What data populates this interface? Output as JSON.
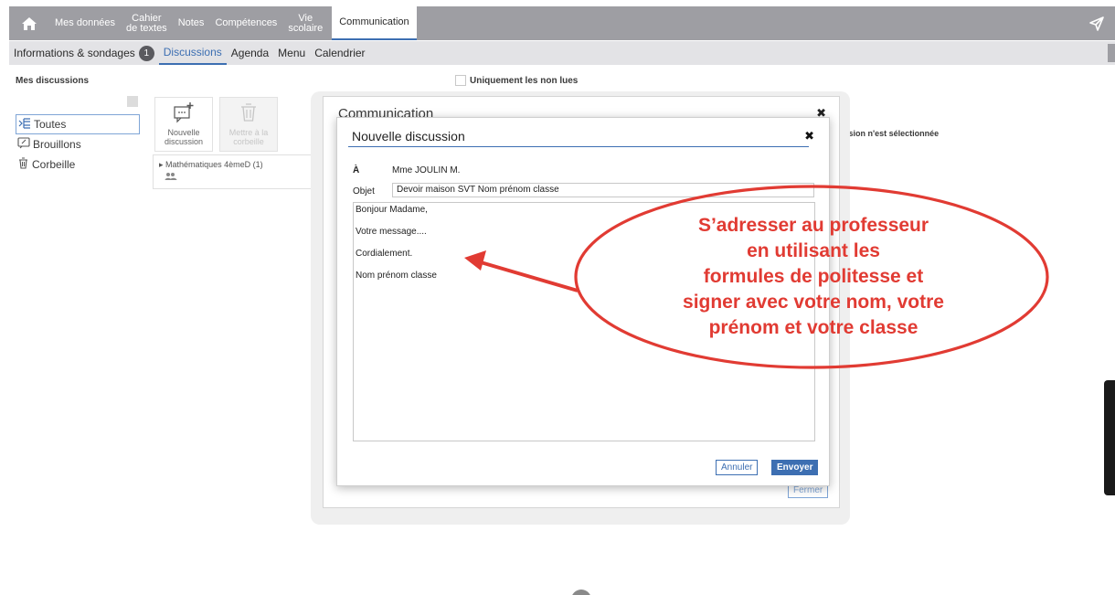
{
  "topnav": {
    "items": [
      {
        "label": "Mes données"
      },
      {
        "line1": "Cahier",
        "line2": "de textes"
      },
      {
        "label": "Notes"
      },
      {
        "label": "Compétences"
      },
      {
        "line1": "Vie",
        "line2": "scolaire"
      },
      {
        "label": "Communication",
        "active": true
      }
    ]
  },
  "subnav": {
    "items": [
      {
        "label": "Informations & sondages",
        "badge": "1"
      },
      {
        "label": "Discussions",
        "active": true
      },
      {
        "label": "Agenda"
      },
      {
        "label": "Menu"
      },
      {
        "label": "Calendrier"
      }
    ]
  },
  "sidebar": {
    "title": "Mes discussions",
    "items": [
      {
        "label": "Toutes",
        "active": true
      },
      {
        "label": "Brouillons"
      },
      {
        "label": "Corbeille"
      }
    ]
  },
  "filter": {
    "unread_label": "Uniquement les non lues"
  },
  "toolbar": {
    "new_line1": "Nouvelle",
    "new_line2": "discussion",
    "trash_line1": "Mettre à la",
    "trash_line2": "corbeille"
  },
  "discussion_list": [
    {
      "label": "Mathématiques 4èmeD (1)"
    }
  ],
  "detail": {
    "no_selection": "ussion n'est sélectionnée"
  },
  "outer_dialog": {
    "title": "Communication",
    "close_label": "Fermer"
  },
  "new_discussion": {
    "title": "Nouvelle discussion",
    "to_label": "À",
    "to_value": "Mme JOULIN M.",
    "subject_label": "Objet",
    "subject_value": "Devoir maison SVT Nom prénom classe",
    "message_lines": [
      "Bonjour Madame,",
      "Votre message....",
      "Cordialement.",
      "Nom prénom classe"
    ],
    "cancel_label": "Annuler",
    "send_label": "Envoyer"
  },
  "annotation": {
    "lines": [
      "S’adresser au professeur",
      "en utilisant les",
      "formules de politesse et",
      "signer avec votre nom, votre",
      "prénom et votre classe"
    ],
    "color": "#e13b33"
  },
  "colors": {
    "nav_bg": "#9e9ea3",
    "accent": "#3d6fb2",
    "annotation": "#e13b33"
  }
}
